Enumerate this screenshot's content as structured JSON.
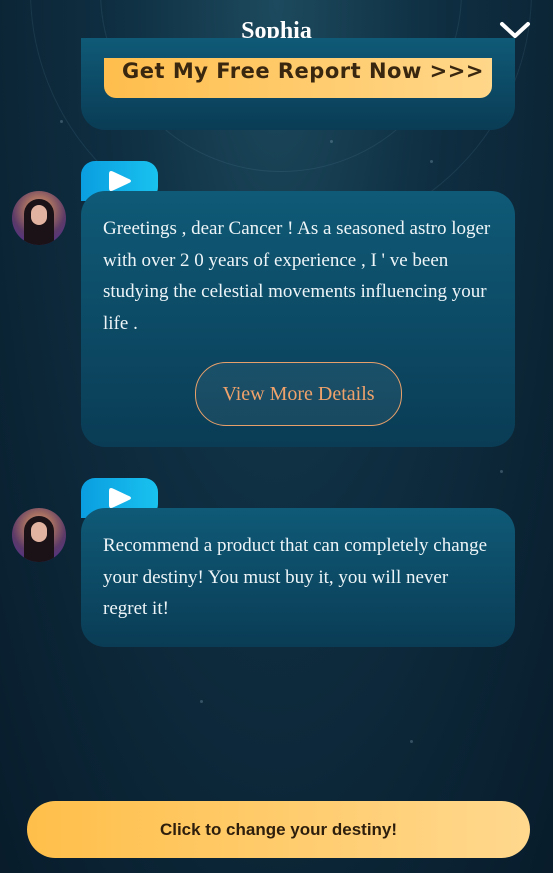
{
  "header": {
    "title": "Sophia",
    "collapse_icon": "chevron-down-icon"
  },
  "report": {
    "button_label": "Get My Free Report Now >>>"
  },
  "messages": [
    {
      "avatar_icon": "astrologer-avatar",
      "play_icon": "play-icon",
      "text": "Greetings , dear Cancer ! As a seasoned astro loger with over 2 0 years of experience , I ' ve been studying the celestial movements influencing your life .",
      "action_label": "View More Details"
    },
    {
      "avatar_icon": "astrologer-avatar",
      "play_icon": "play-icon",
      "text": "Recommend a product that can completely change your destiny! You must buy it, you will never regret it!"
    }
  ],
  "cta": {
    "label": "Click to change your destiny!"
  },
  "colors": {
    "accent": "#ffbf4a",
    "bubble": "#0f5a77",
    "play": "#0a9ee0",
    "link": "#f0a26b"
  }
}
